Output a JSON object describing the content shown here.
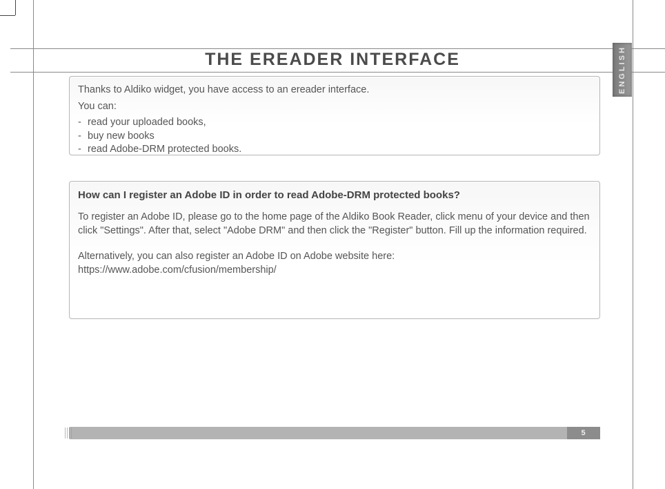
{
  "lang_tab": "ENGLISH",
  "title": "THE EREADER INTERFACE",
  "card1": {
    "intro1": "Thanks to Aldiko widget, you have access to an ereader interface.",
    "intro2": "You can:",
    "bullets": [
      "read your uploaded books,",
      "buy new books",
      "read Adobe-DRM protected books."
    ]
  },
  "card2": {
    "heading": "How can I register an Adobe ID in order to read Adobe-DRM protected books?",
    "para1": "To register an Adobe ID, please go to the home page of the Aldiko Book Reader, click menu of your device and then click \"Settings\". After that, select \"Adobe DRM\" and then click the \"Register\" button. Fill up the information required.",
    "para2": "Alternatively, you can also register an Adobe ID on Adobe website here: https://www.adobe.com/cfusion/membership/"
  },
  "page_number": "5"
}
